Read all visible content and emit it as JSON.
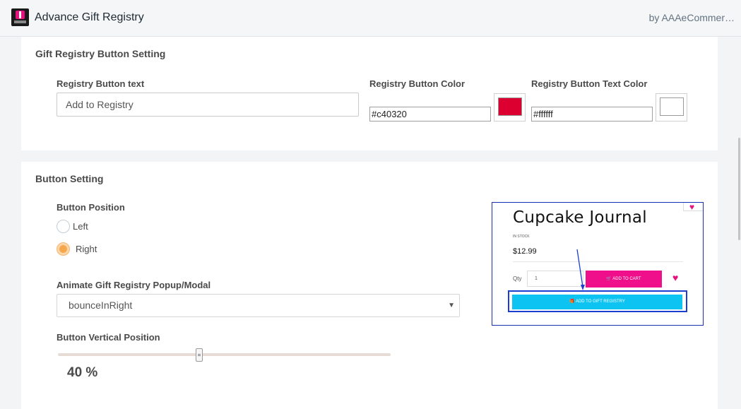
{
  "header": {
    "app_title": "Advance Gift Registry",
    "author": "by AAAeCommer…"
  },
  "registry_button_setting": {
    "title": "Gift Registry Button Setting",
    "text_label": "Registry Button text",
    "text_value": "Add to Registry",
    "color_label": "Registry Button Color",
    "color_value": "#c40320",
    "text_color_label": "Registry Button Text Color",
    "text_color_value": "#ffffff"
  },
  "button_setting": {
    "title": "Button Setting",
    "position_label": "Button Position",
    "positions": [
      {
        "label": "Left",
        "checked": false
      },
      {
        "label": "Right",
        "checked": true
      }
    ],
    "animate_label": "Animate Gift Registry Popup/Modal",
    "animate_value": "bounceInRight",
    "vertical_label": "Button Vertical Position",
    "vertical_percent": 40,
    "vertical_display": "40 %"
  },
  "preview": {
    "product_title": "Cupcake Journal",
    "stock": "IN STOCK",
    "price": "$12.99",
    "qty_label": "Qty",
    "qty_value": "1",
    "add_to_cart": "ADD TO CART",
    "add_to_registry": "ADD TO GIFT REGISTRY"
  },
  "colors": {
    "accent": "#f6a84f",
    "cart_button": "#ef0f8a",
    "registry_preview_button": "#0dc3f2",
    "highlight_box": "#1a3fd0"
  }
}
